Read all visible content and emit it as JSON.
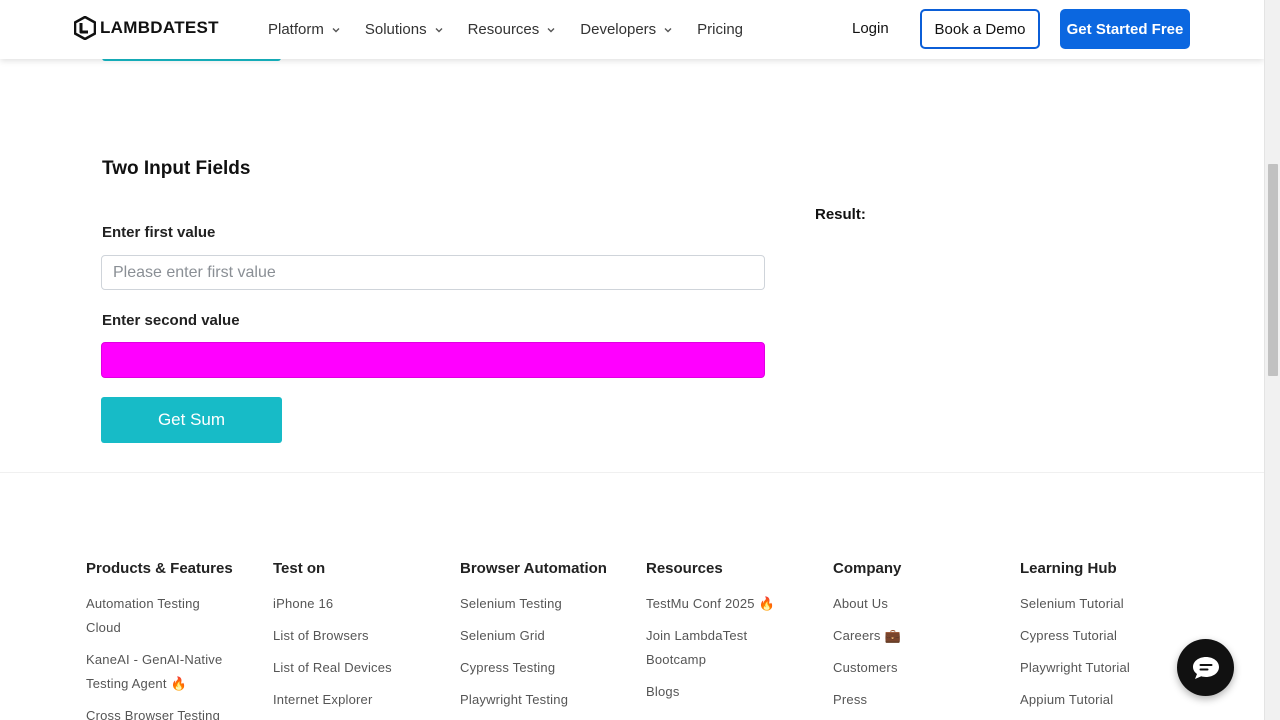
{
  "brand": {
    "name": "LAMBDATEST"
  },
  "nav": {
    "items": [
      {
        "label": "Platform"
      },
      {
        "label": "Solutions"
      },
      {
        "label": "Resources"
      },
      {
        "label": "Developers"
      }
    ],
    "pricing": "Pricing",
    "login": "Login",
    "book_demo": "Book a Demo",
    "get_started": "Get Started Free"
  },
  "form": {
    "title": "Two Input Fields",
    "first_label": "Enter first value",
    "first_placeholder": "Please enter first value",
    "first_value": "",
    "second_label": "Enter second value",
    "second_value": "",
    "submit_label": "Get Sum",
    "result_label": "Result:"
  },
  "colors": {
    "accent_teal": "#17bbc7",
    "primary_blue": "#0b67e0",
    "highlight_magenta": "#ff00ff"
  },
  "footer": {
    "columns": [
      {
        "title": "Products & Features",
        "links": [
          "Automation Testing Cloud",
          "KaneAI - GenAI-Native Testing Agent 🔥",
          "Cross Browser Testing"
        ]
      },
      {
        "title": "Test on",
        "links": [
          "iPhone 16",
          "List of Browsers",
          "List of Real Devices",
          "Internet Explorer"
        ]
      },
      {
        "title": "Browser Automation",
        "links": [
          "Selenium Testing",
          "Selenium Grid",
          "Cypress Testing",
          "Playwright Testing"
        ]
      },
      {
        "title": "Resources",
        "links": [
          "TestMu Conf 2025 🔥",
          "Join LambdaTest Bootcamp",
          "Blogs"
        ]
      },
      {
        "title": "Company",
        "links": [
          "About Us",
          "Careers 💼",
          "Customers",
          "Press"
        ]
      },
      {
        "title": "Learning Hub",
        "links": [
          "Selenium Tutorial",
          "Cypress Tutorial",
          "Playwright Tutorial",
          "Appium Tutorial"
        ]
      }
    ]
  },
  "chat": {
    "icon": "chat-bubble-icon"
  }
}
